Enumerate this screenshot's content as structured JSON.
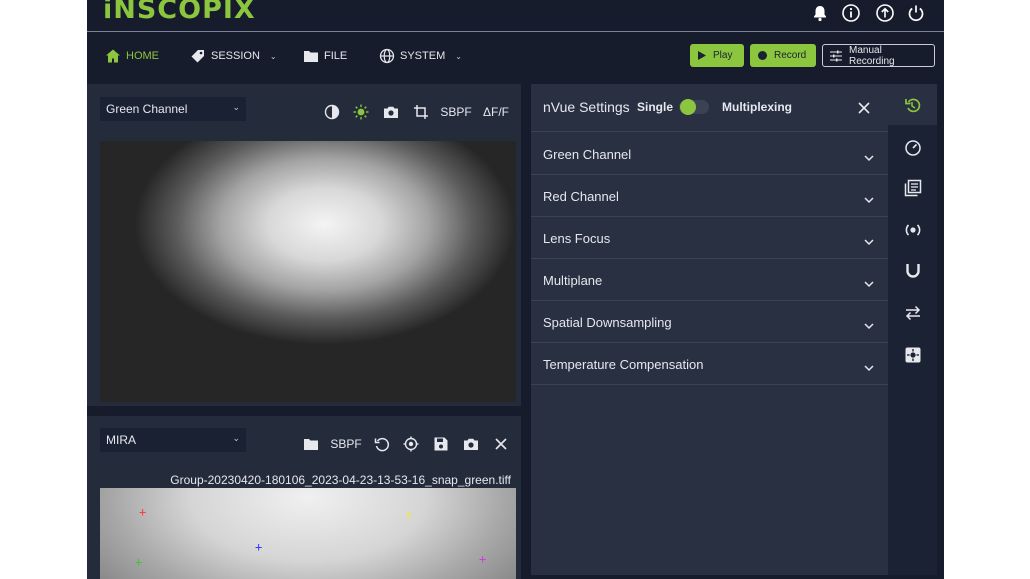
{
  "app": {
    "logo": "iNSCOPIX"
  },
  "nav": {
    "home": "HOME",
    "session": "SESSION",
    "file": "FILE",
    "system": "SYSTEM",
    "play": "Play",
    "record": "Record",
    "manual_recording": "Manual Recording"
  },
  "viewer_top": {
    "channel_select": "Green Channel",
    "sbpf": "SBPF",
    "dff": "ΔF/F"
  },
  "viewer_bottom": {
    "source_select": "MIRA",
    "sbpf": "SBPF",
    "filename": "Group-20230420-180106_2023-04-23-13-53-16_snap_green.tiff",
    "markers": [
      {
        "symbol": "+",
        "color": "#ff3b3b"
      },
      {
        "symbol": "+",
        "color": "#f2e63c"
      },
      {
        "symbol": "+",
        "color": "#2b3bff"
      },
      {
        "symbol": "+",
        "color": "#3cc43c"
      },
      {
        "symbol": "+",
        "color": "#d23cd2"
      }
    ]
  },
  "settings": {
    "title": "nVue Settings",
    "mode_left": "Single",
    "mode_right": "Multiplexing",
    "sections": [
      "Green Channel",
      "Red Channel",
      "Lens Focus",
      "Multiplane",
      "Spatial Downsampling",
      "Temperature Compensation"
    ]
  },
  "colors": {
    "accent": "#8cc63f",
    "background": "#161c2b",
    "panel": "#242b3b"
  }
}
